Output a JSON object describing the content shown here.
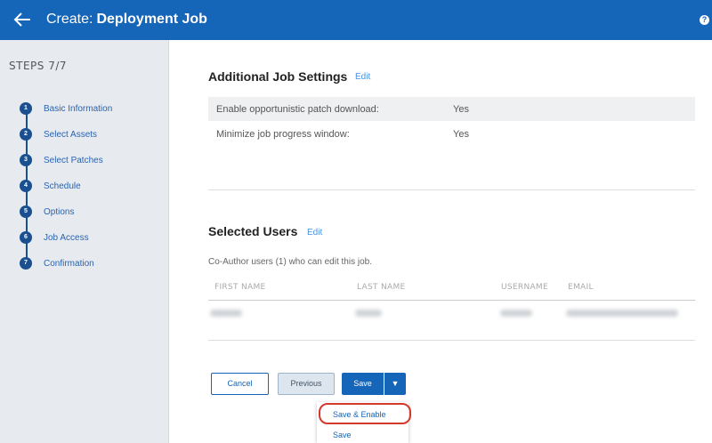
{
  "header": {
    "prefix": "Create:",
    "name": "Deployment Job",
    "help_glyph": "?",
    "bg_color": "#1565b8"
  },
  "sidebar": {
    "steps_label": "STEPS 7/7",
    "steps": [
      {
        "num": "1",
        "label": "Basic Information"
      },
      {
        "num": "2",
        "label": "Select Assets"
      },
      {
        "num": "3",
        "label": "Select Patches"
      },
      {
        "num": "4",
        "label": "Schedule"
      },
      {
        "num": "5",
        "label": "Options"
      },
      {
        "num": "6",
        "label": "Job Access"
      },
      {
        "num": "7",
        "label": "Confirmation"
      }
    ]
  },
  "additional_settings": {
    "title": "Additional Job Settings",
    "edit_label": "Edit",
    "rows": [
      {
        "label": "Enable opportunistic patch download:",
        "value": "Yes"
      },
      {
        "label": "Minimize job progress window:",
        "value": "Yes"
      }
    ]
  },
  "selected_users": {
    "title": "Selected Users",
    "edit_label": "Edit",
    "description": "Co-Author users (1) who can edit this job.",
    "columns": [
      "FIRST NAME",
      "LAST NAME",
      "USERNAME",
      "EMAIL"
    ]
  },
  "actions": {
    "cancel": "Cancel",
    "previous": "Previous",
    "save": "Save",
    "caret": "▼"
  },
  "save_menu": {
    "items": [
      "Save & Enable",
      "Save"
    ]
  },
  "icons": {
    "back": "arrow-left-icon",
    "help": "help-icon",
    "dropdown": "caret-down-icon"
  }
}
